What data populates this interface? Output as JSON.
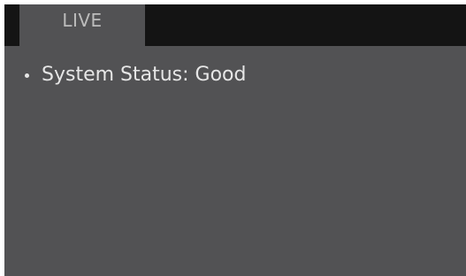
{
  "tabs": [
    {
      "label": "LIVE",
      "active": true
    }
  ],
  "status": {
    "label": "System Status: Good"
  },
  "colors": {
    "panel": "#525254",
    "tab_strip": "#141414",
    "tab_text": "#bcbcbc",
    "status_text": "#e6e6e6"
  }
}
